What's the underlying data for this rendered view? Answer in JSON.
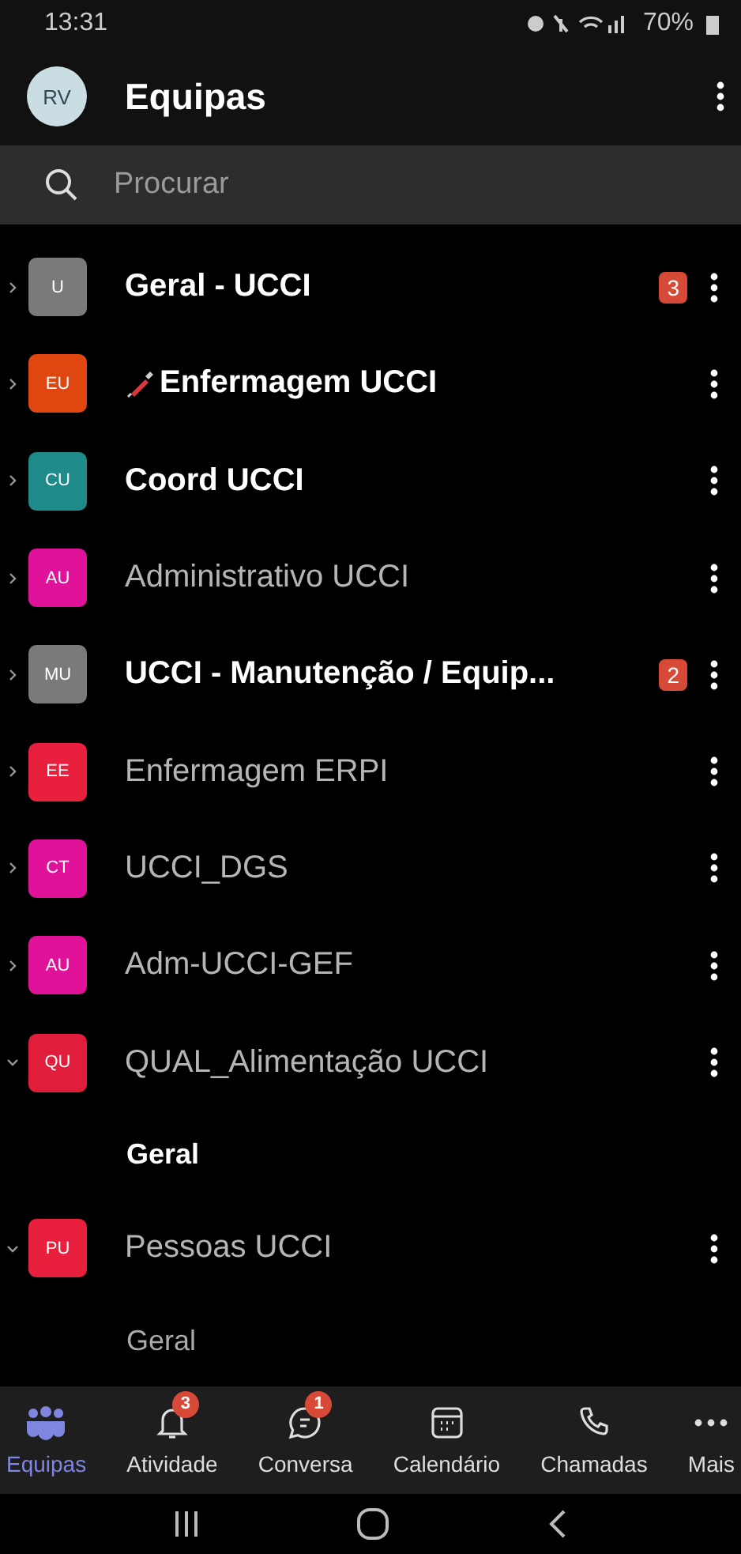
{
  "status_bar": {
    "time": "13:31",
    "battery": "70%"
  },
  "header": {
    "avatar": "RV",
    "title": "Equipas"
  },
  "search": {
    "placeholder": "Procurar"
  },
  "teams": [
    {
      "initials": "U",
      "color": "#7a7a7a",
      "name": "Geral - UCCI",
      "bold": true,
      "badge": "3",
      "expanded": false,
      "has_icon": false
    },
    {
      "initials": "EU",
      "color": "#e0460f",
      "name": "Enfermagem UCCI",
      "bold": true,
      "expanded": false,
      "has_icon": true
    },
    {
      "initials": "CU",
      "color": "#1f8a8a",
      "name": "Coord UCCI",
      "bold": true,
      "expanded": false,
      "has_icon": false
    },
    {
      "initials": "AU",
      "color": "#e0129a",
      "name": "Administrativo UCCI",
      "bold": false,
      "expanded": false,
      "has_icon": false
    },
    {
      "initials": "MU",
      "color": "#7a7a7a",
      "name": "UCCI - Manutenção / Equip...",
      "bold": true,
      "badge": "2",
      "expanded": false,
      "has_icon": false
    },
    {
      "initials": "EE",
      "color": "#e8203e",
      "name": "Enfermagem ERPI",
      "bold": false,
      "expanded": false,
      "has_icon": false
    },
    {
      "initials": "CT",
      "color": "#e0129a",
      "name": "UCCI_DGS",
      "bold": false,
      "expanded": false,
      "has_icon": false
    },
    {
      "initials": "AU",
      "color": "#e0129a",
      "name": "Adm-UCCI-GEF",
      "bold": false,
      "expanded": false,
      "has_icon": false
    },
    {
      "initials": "QU",
      "color": "#e01e3c",
      "name": "QUAL_Alimentação UCCI",
      "bold": false,
      "expanded": true,
      "has_icon": false,
      "children": [
        {
          "name": "Geral",
          "bold": true
        }
      ]
    },
    {
      "initials": "PU",
      "color": "#e8203e",
      "name": "Pessoas UCCI",
      "bold": false,
      "expanded": true,
      "has_icon": false,
      "children": [
        {
          "name": "Geral",
          "bold": false
        }
      ]
    }
  ],
  "nav": [
    {
      "kind": "teams",
      "label": "Equipas",
      "selected": true
    },
    {
      "kind": "bell",
      "label": "Atividade",
      "selected": false,
      "badge": "3"
    },
    {
      "kind": "chat",
      "label": "Conversa",
      "selected": false,
      "badge": "1"
    },
    {
      "kind": "calendar",
      "label": "Calendário",
      "selected": false
    },
    {
      "kind": "phone",
      "label": "Chamadas",
      "selected": false
    },
    {
      "kind": "more",
      "label": "Mais",
      "selected": false
    }
  ]
}
